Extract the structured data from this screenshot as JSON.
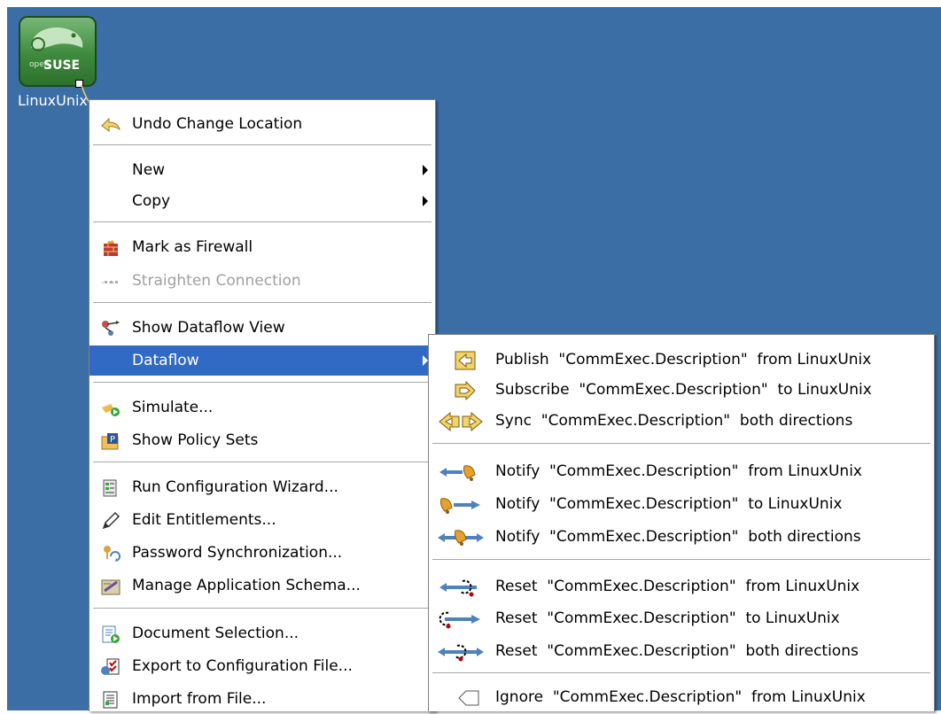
{
  "desktop": {
    "background_color": "#3a6ea5",
    "icon": {
      "label": "LinuxUnix",
      "logo_text": "SUSE",
      "logo_subtext": "open"
    }
  },
  "context_menu": {
    "items": [
      {
        "label": "Undo Change Location",
        "icon": "undo-arrow-icon"
      },
      {
        "label": "New",
        "has_submenu": true
      },
      {
        "label": "Copy",
        "has_submenu": true
      },
      {
        "label": "Mark as Firewall",
        "icon": "firewall-icon"
      },
      {
        "label": "Straighten Connection",
        "icon": "straighten-connection-icon",
        "disabled": true
      },
      {
        "label": "Show Dataflow View",
        "icon": "dataflow-view-icon"
      },
      {
        "label": "Dataflow",
        "has_submenu": true,
        "highlighted": true
      },
      {
        "label": "Simulate...",
        "icon": "simulate-icon"
      },
      {
        "label": "Show Policy Sets",
        "icon": "policy-sets-icon"
      },
      {
        "label": "Run Configuration Wizard...",
        "icon": "configuration-wizard-icon"
      },
      {
        "label": "Edit Entitlements...",
        "icon": "pencil-icon"
      },
      {
        "label": "Password Synchronization...",
        "icon": "password-sync-icon"
      },
      {
        "label": "Manage Application Schema...",
        "icon": "application-schema-icon"
      },
      {
        "label": "Document Selection...",
        "icon": "document-selection-icon"
      },
      {
        "label": "Export to Configuration File...",
        "icon": "export-config-icon"
      },
      {
        "label": "Import from File...",
        "icon": "import-file-icon"
      }
    ]
  },
  "dataflow_submenu": {
    "items": [
      {
        "label": "Publish  \"CommExec.Description\"  from LinuxUnix",
        "icon": "publish-arrow-icon"
      },
      {
        "label": "Subscribe  \"CommExec.Description\"  to LinuxUnix",
        "icon": "subscribe-arrow-icon"
      },
      {
        "label": "Sync  \"CommExec.Description\"  both directions",
        "icon": "sync-arrows-icon"
      },
      {
        "label": "Notify  \"CommExec.Description\"  from LinuxUnix",
        "icon": "notify-from-icon"
      },
      {
        "label": "Notify  \"CommExec.Description\"  to LinuxUnix",
        "icon": "notify-to-icon"
      },
      {
        "label": "Notify  \"CommExec.Description\"  both directions",
        "icon": "notify-both-icon"
      },
      {
        "label": "Reset  \"CommExec.Description\"  from LinuxUnix",
        "icon": "reset-from-icon"
      },
      {
        "label": "Reset  \"CommExec.Description\"  to LinuxUnix",
        "icon": "reset-to-icon"
      },
      {
        "label": "Reset  \"CommExec.Description\"  both directions",
        "icon": "reset-both-icon"
      },
      {
        "label": "Ignore  \"CommExec.Description\"  from LinuxUnix",
        "icon": "ignore-icon"
      }
    ]
  },
  "colors": {
    "menu_highlight": "#316ac5",
    "disabled_text": "#a0a0a0"
  }
}
